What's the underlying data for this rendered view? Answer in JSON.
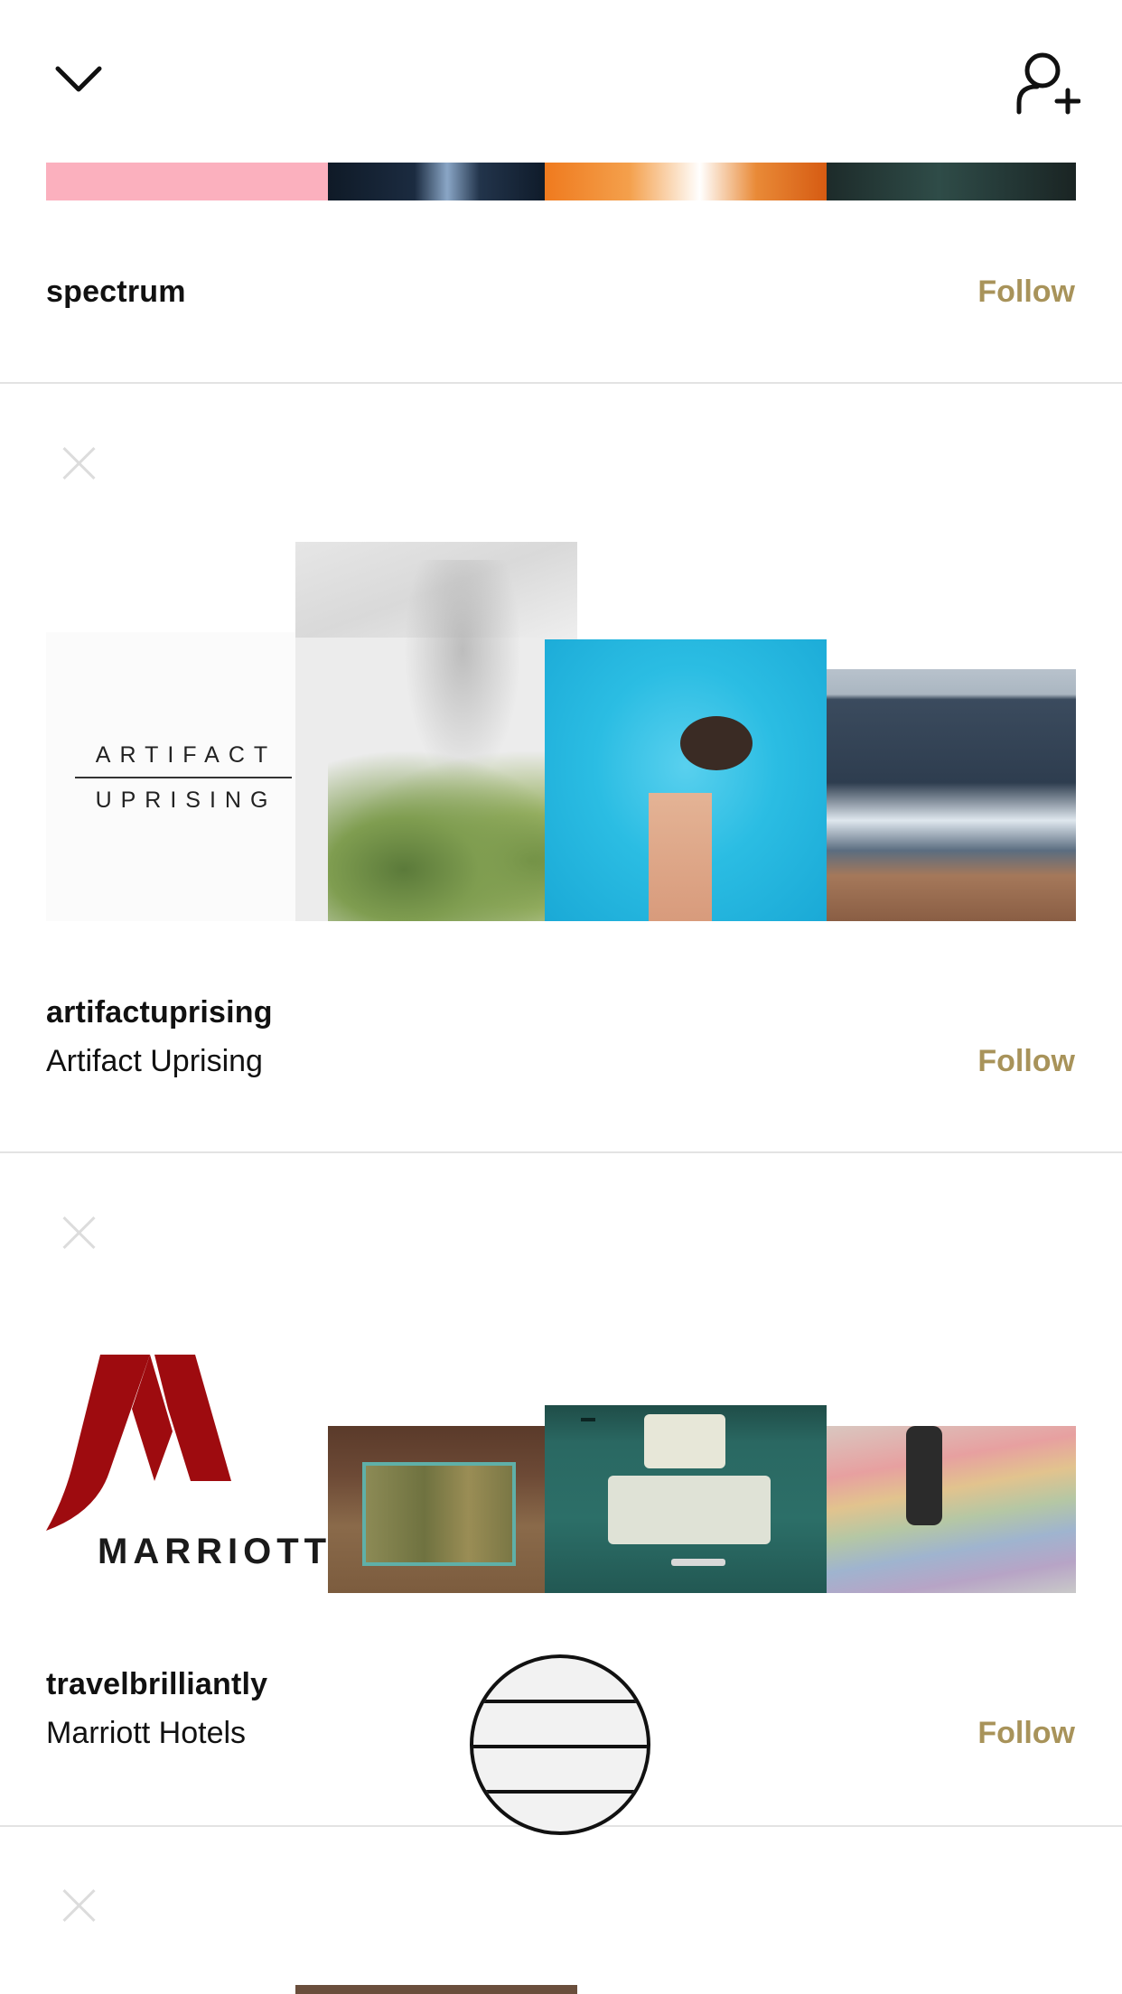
{
  "topbar": {
    "collapse_icon": "chevron-down-icon",
    "add_user_icon": "add-user-icon"
  },
  "accounts": [
    {
      "username": "spectrum",
      "display_name": "",
      "follow_label": "Follow"
    },
    {
      "username": "artifactuprising",
      "display_name": "Artifact Uprising",
      "follow_label": "Follow",
      "logo_line1": "ARTIFACT",
      "logo_line2": "UPRISING"
    },
    {
      "username": "travelbrilliantly",
      "display_name": "Marriott Hotels",
      "follow_label": "Follow",
      "logo_text": "MARRIOTT"
    }
  ],
  "colors": {
    "follow": "#a8935a",
    "divider": "#e3e3e3",
    "marriott_red": "#9e0b0f"
  },
  "menu_button_icon": "menu-icon"
}
